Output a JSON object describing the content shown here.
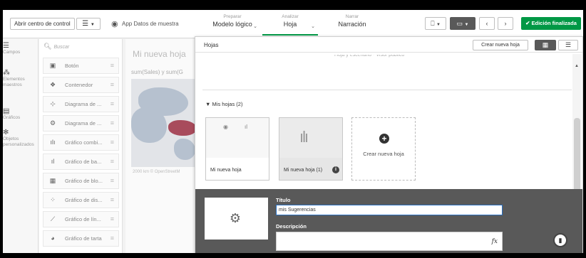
{
  "toolbar": {
    "open_hub_label": "Abrir centro de control",
    "menu_icon": "hamburger-icon",
    "app_name": "App Datos de muestra",
    "stages": [
      {
        "small": "Preparar",
        "big": "Modelo lógico"
      },
      {
        "small": "Analizar",
        "big": "Hoja"
      },
      {
        "small": "Narrar",
        "big": "Narración"
      }
    ],
    "active_stage": "Hoja",
    "done_label": "Edición finalizada",
    "accent_color": "#009845"
  },
  "rail": {
    "items": [
      {
        "label": "Campos",
        "icon": "database-icon"
      },
      {
        "label": "Elementos maestros",
        "icon": "link-icon"
      },
      {
        "label": "Gráficos",
        "icon": "chart-icon"
      },
      {
        "label": "Objetos personalizados",
        "icon": "puzzle-icon"
      }
    ]
  },
  "assets": {
    "search_placeholder": "Buscar",
    "items": [
      {
        "label": "Botón",
        "icon": "button-icon"
      },
      {
        "label": "Contenedor",
        "icon": "container-icon"
      },
      {
        "label": "Diagrama de ...",
        "icon": "diagram-icon"
      },
      {
        "label": "Diagrama de ...",
        "icon": "diagram-2-icon"
      },
      {
        "label": "Gráfico combi...",
        "icon": "combo-chart-icon"
      },
      {
        "label": "Gráfico de ba...",
        "icon": "bar-chart-icon"
      },
      {
        "label": "Gráfico de blo...",
        "icon": "block-chart-icon"
      },
      {
        "label": "Gráfico de dis...",
        "icon": "scatter-chart-icon"
      },
      {
        "label": "Gráfico de lín...",
        "icon": "line-chart-icon"
      },
      {
        "label": "Gráfico de tarta",
        "icon": "pie-chart-icon"
      }
    ]
  },
  "canvas": {
    "sheet_title": "Mi nueva hoja",
    "chart_title": "sum(Sales) y sum(G",
    "map_scale": "2000 km  © OpenStreetM"
  },
  "sheets_panel": {
    "title": "Hojas",
    "new_sheet_label": "Crear nueva hoja",
    "cut_text": "Hoja y escenario - Visor público",
    "section_label": "Mis hojas (2)",
    "sheets": [
      {
        "label": "Mi nueva hoja"
      },
      {
        "label": "Mi nueva hoja (1)"
      }
    ],
    "new_card_label": "Crear nueva hoja",
    "detail": {
      "title_label": "Título",
      "title_value": "mis Sugerencias",
      "description_label": "Descripción",
      "fx_label": "fx"
    }
  }
}
